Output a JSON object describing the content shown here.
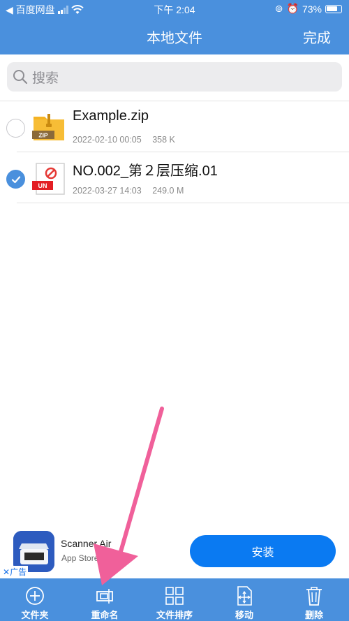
{
  "status_bar": {
    "back_app": "◀ 百度网盘",
    "time": "下午 2:04",
    "battery": "73%"
  },
  "nav": {
    "title": "本地文件",
    "done": "完成"
  },
  "search": {
    "placeholder": "搜索"
  },
  "files": [
    {
      "name": "Example.zip",
      "date": "2022-02-10 00:05",
      "size": "358 K",
      "badge": "ZIP",
      "selected": false
    },
    {
      "name": "NO.002_第２层压缩.01",
      "date": "2022-03-27 14:03",
      "size": "249.0 M",
      "badge": "UN",
      "selected": true
    }
  ],
  "ad": {
    "app_name": "Scanner Air",
    "store": "App Store",
    "install": "安装",
    "tag": "广告"
  },
  "toolbar": {
    "items": [
      {
        "label": "文件夹",
        "icon": "plus-circle-icon"
      },
      {
        "label": "重命名",
        "icon": "rename-icon"
      },
      {
        "label": "文件排序",
        "icon": "grid-icon"
      },
      {
        "label": "移动",
        "icon": "move-icon"
      },
      {
        "label": "删除",
        "icon": "trash-icon"
      }
    ]
  },
  "colors": {
    "accent": "#4a90dd",
    "install_button": "#0a7af2",
    "annotation_arrow": "#f0609a"
  }
}
